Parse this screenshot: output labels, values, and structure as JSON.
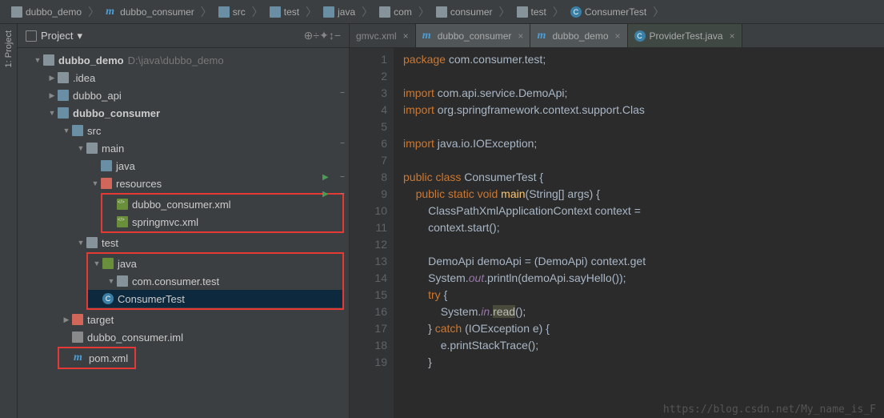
{
  "breadcrumb": [
    {
      "icon": "folder",
      "label": "dubbo_demo"
    },
    {
      "icon": "maven",
      "label": "dubbo_consumer"
    },
    {
      "icon": "folder-blue",
      "label": "src"
    },
    {
      "icon": "folder-blue",
      "label": "test"
    },
    {
      "icon": "folder-blue",
      "label": "java"
    },
    {
      "icon": "folder-gray",
      "label": "com"
    },
    {
      "icon": "folder-gray",
      "label": "consumer"
    },
    {
      "icon": "folder-gray",
      "label": "test"
    },
    {
      "icon": "class",
      "label": "ConsumerTest"
    }
  ],
  "sidebar_label": "1: Project",
  "project_panel": {
    "title": "Project",
    "dropdown": "▾",
    "buttons": [
      "⊕",
      "÷",
      "✦",
      "↕",
      "−"
    ]
  },
  "tree": [
    {
      "d": 0,
      "t": "▼",
      "i": "folder",
      "l": "dubbo_demo",
      "suf": "D:\\java\\dubbo_demo",
      "bold": true
    },
    {
      "d": 1,
      "t": "▶",
      "i": "folder-gray",
      "l": ".idea"
    },
    {
      "d": 1,
      "t": "▶",
      "i": "folder-blue",
      "l": "dubbo_api"
    },
    {
      "d": 1,
      "t": "▼",
      "i": "folder-blue",
      "l": "dubbo_consumer",
      "bold": true
    },
    {
      "d": 2,
      "t": "▼",
      "i": "folder-blue",
      "l": "src"
    },
    {
      "d": 3,
      "t": "▼",
      "i": "folder-gray",
      "l": "main"
    },
    {
      "d": 4,
      "t": "",
      "i": "folder-blue",
      "l": "java"
    },
    {
      "d": 4,
      "t": "▼",
      "i": "folder-orange",
      "l": "resources"
    },
    {
      "d": 5,
      "t": "",
      "i": "xml",
      "l": "dubbo_consumer.xml",
      "red": "start"
    },
    {
      "d": 5,
      "t": "",
      "i": "xml",
      "l": "springmvc.xml",
      "red": "end"
    },
    {
      "d": 3,
      "t": "▼",
      "i": "folder-gray",
      "l": "test"
    },
    {
      "d": 4,
      "t": "▼",
      "i": "folder-green",
      "l": "java",
      "red": "start"
    },
    {
      "d": 5,
      "t": "▼",
      "i": "folder-gray",
      "l": "com.consumer.test"
    },
    {
      "d": 6,
      "t": "",
      "i": "class",
      "l": "ConsumerTest",
      "sel": true,
      "red": "end"
    },
    {
      "d": 2,
      "t": "▶",
      "i": "folder-orange",
      "l": "target"
    },
    {
      "d": 2,
      "t": "",
      "i": "file",
      "l": "dubbo_consumer.iml"
    },
    {
      "d": 2,
      "t": "",
      "i": "maven",
      "l": "pom.xml",
      "red": "single"
    }
  ],
  "tabs": [
    {
      "i": "",
      "l": "gmvc.xml",
      "cls": "gmvc",
      "close": true
    },
    {
      "i": "maven",
      "l": "dubbo_consumer",
      "close": true
    },
    {
      "i": "maven",
      "l": "dubbo_demo",
      "close": true
    },
    {
      "i": "class-blue",
      "l": "ProviderTest.java",
      "cls": "prov",
      "close": true
    }
  ],
  "code": {
    "lines": [
      {
        "n": 1,
        "html": "<span class='k'>package</span> <span class='s'>com.consumer.test;</span>"
      },
      {
        "n": 2,
        "html": ""
      },
      {
        "n": 3,
        "html": "<span class='k'>import</span> <span class='s'>com.api.service.DemoApi;</span>",
        "fold": "−"
      },
      {
        "n": 4,
        "html": "<span class='k'>import</span> <span class='s'>org.springframework.context.support.Clas</span>"
      },
      {
        "n": 5,
        "html": ""
      },
      {
        "n": 6,
        "html": "<span class='k'>import</span> <span class='s'>java.io.IOException;</span>",
        "fold": "−"
      },
      {
        "n": 7,
        "html": ""
      },
      {
        "n": 8,
        "html": "<span class='k'>public class</span> <span class='cls'>ConsumerTest</span> <span class='s'>{</span>",
        "run": true,
        "fold": "−"
      },
      {
        "n": 9,
        "html": "    <span class='k'>public static void</span> <span class='m'>main</span><span class='s'>(String[] args) {</span>",
        "run": true,
        "fold": "−"
      },
      {
        "n": 10,
        "html": "        <span class='s'>ClassPathXmlApplicationContext context =</span>"
      },
      {
        "n": 11,
        "html": "        <span class='s'>context.start();</span>"
      },
      {
        "n": 12,
        "html": ""
      },
      {
        "n": 13,
        "html": "        <span class='s'>DemoApi demoApi = (DemoApi) context.get</span>"
      },
      {
        "n": 14,
        "html": "        <span class='s'>System.</span><span class='fld'>out</span><span class='s'>.println(demoApi.sayHello());</span>"
      },
      {
        "n": 15,
        "html": "        <span class='k'>try</span> <span class='s'>{</span>"
      },
      {
        "n": 16,
        "html": "            <span class='s'>System.</span><span class='fld'>in</span><span class='s'>.</span><span class='hl'>read</span><span class='s'>();</span>"
      },
      {
        "n": 17,
        "html": "        <span class='s'>}</span> <span class='k'>catch</span> <span class='s'>(IOException e) {</span>"
      },
      {
        "n": 18,
        "html": "            <span class='s'>e.printStackTrace();</span>"
      },
      {
        "n": 19,
        "html": "        <span class='s'>}</span>"
      }
    ]
  },
  "watermark": "https://blog.csdn.net/My_name_is_F"
}
